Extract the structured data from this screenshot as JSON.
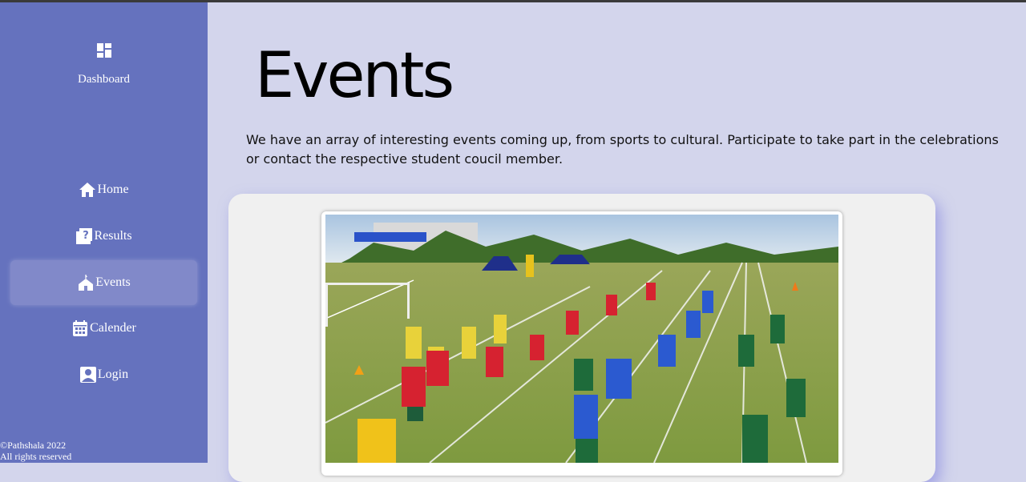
{
  "sidebar": {
    "dashboard_label": "Dashboard",
    "items": [
      {
        "label": "Home",
        "icon": "home-icon"
      },
      {
        "label": "Results",
        "icon": "results-icon"
      },
      {
        "label": "Events",
        "icon": "events-icon",
        "active": true
      },
      {
        "label": "Calender",
        "icon": "calendar-icon"
      },
      {
        "label": "Login",
        "icon": "user-icon"
      }
    ],
    "footer": {
      "copyright": "©Pathshala 2022",
      "rights": "All rights reserved"
    }
  },
  "main": {
    "title": "Events",
    "intro": "We have an array of interesting events coming up, from sports to cultural. Participate to take part in the celebrations or contact the respective student coucil member."
  },
  "colors": {
    "sidebar": "#6572be",
    "sidebar_active": "#8189c9",
    "page_background": "#d3d5ec",
    "card": "#f0f0f0"
  }
}
